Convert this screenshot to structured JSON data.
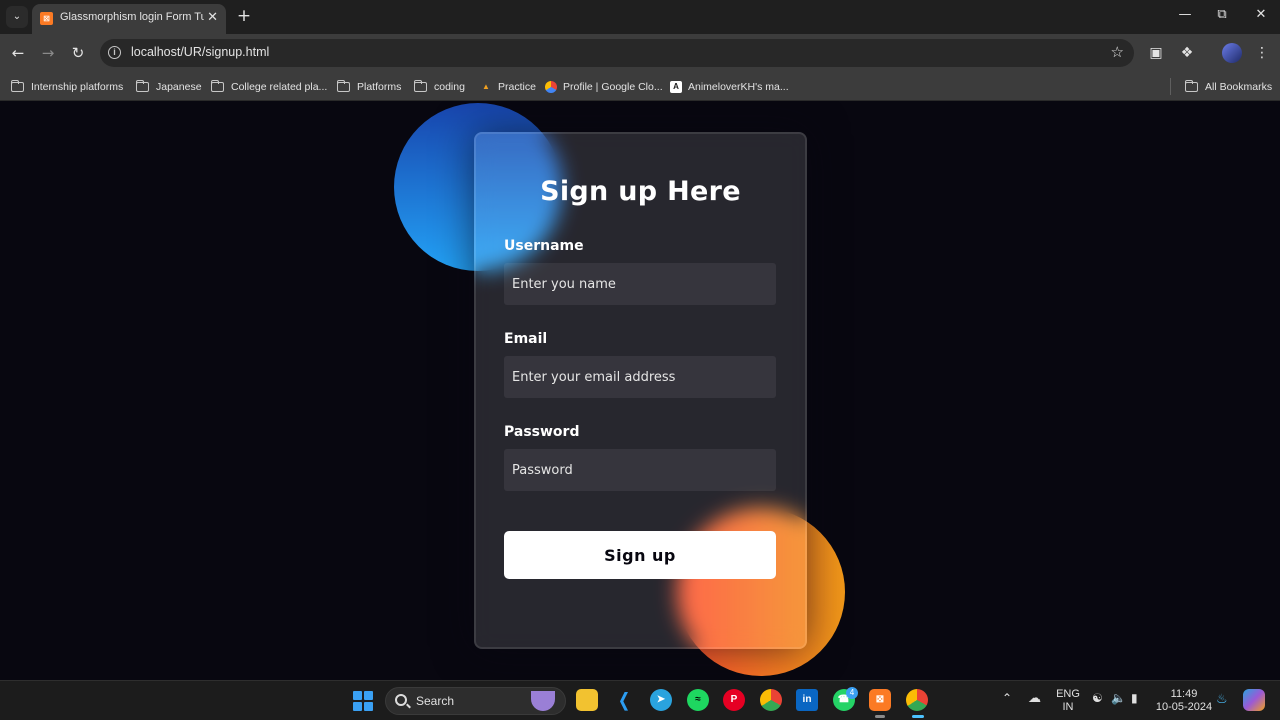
{
  "browser": {
    "tab_title": "Glassmorphism login Form Tuto",
    "url": "localhost/UR/signup.html",
    "bookmarks": [
      {
        "label": "Internship platforms",
        "icon": "folder-icon"
      },
      {
        "label": "Japanese",
        "icon": "folder-icon"
      },
      {
        "label": "College related pla...",
        "icon": "folder-icon"
      },
      {
        "label": "Platforms",
        "icon": "folder-icon"
      },
      {
        "label": "coding",
        "icon": "folder-icon"
      },
      {
        "label": "Practice",
        "icon": "practice-favicon"
      },
      {
        "label": "Profile | Google Clo...",
        "icon": "google-cloud-favicon"
      },
      {
        "label": "AnimeloverKH's ma...",
        "icon": "anime-favicon"
      }
    ],
    "all_bookmarks": "All Bookmarks"
  },
  "signup": {
    "title": "Sign up Here",
    "username_label": "Username",
    "username_placeholder": "Enter you name",
    "email_label": "Email",
    "email_placeholder": "Enter your email address",
    "password_label": "Password",
    "password_placeholder": "Password",
    "submit_label": "Sign up"
  },
  "colors": {
    "page_background": "#080710",
    "blob_blue": [
      "#1845ad",
      "#23a2f6"
    ],
    "blob_orange": [
      "#ff512f",
      "#f09819"
    ]
  },
  "taskbar": {
    "search_label": "Search",
    "apps": [
      "file-explorer",
      "vscode",
      "telegram",
      "spotify",
      "pinterest",
      "chrome",
      "linkedin",
      "whatsapp",
      "xampp",
      "chrome-active"
    ],
    "whatsapp_badge": "4",
    "language_line1": "ENG",
    "language_line2": "IN",
    "time": "11:49",
    "date": "10-05-2024"
  }
}
